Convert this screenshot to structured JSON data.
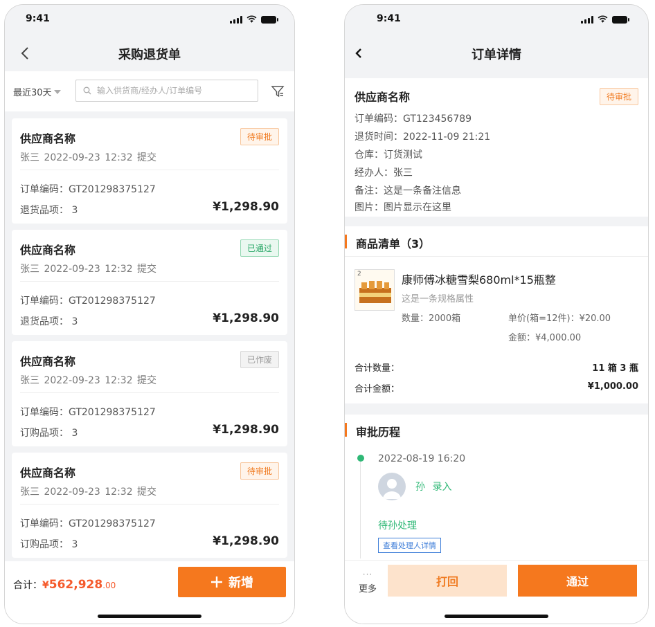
{
  "left": {
    "status_time": "9:41",
    "nav_title": "采购退货单",
    "filter": {
      "range_label": "最近30天",
      "search_placeholder": "输入供货商/经办人/订单编号"
    },
    "cards": [
      {
        "supplier": "供应商名称",
        "status": "待审批",
        "submit_line": "张三 2022-09-23 12:32 提交",
        "order_no": "订单编码：GT201298375127",
        "items": "退货品项： 3",
        "amount": "¥1,298.90"
      },
      {
        "supplier": "供应商名称",
        "status": "已通过",
        "submit_line": "张三 2022-09-23 12:32 提交",
        "order_no": "订单编码：GT201298375127",
        "items": "退货品项： 3",
        "amount": "¥1,298.90"
      },
      {
        "supplier": "供应商名称",
        "status": "已作废",
        "submit_line": "张三 2022-09-23 12:32 提交",
        "order_no": "订单编码：GT201298375127",
        "items": "订购品项： 3",
        "amount": "¥1,298.90"
      },
      {
        "supplier": "供应商名称",
        "status": "待审批",
        "submit_line": "张三 2022-09-23 12:32 提交",
        "order_no": "订单编码：GT201298375127",
        "items": "订购品项： 3",
        "amount": "¥1,298.90"
      }
    ],
    "bottom": {
      "total_label": "合计：",
      "total_symbol": "¥",
      "total_main": "562,928",
      "total_decimal": ".00",
      "add_label": "新增"
    }
  },
  "right": {
    "status_time": "9:41",
    "nav_title": "订单详情",
    "info": {
      "supplier": "供应商名称",
      "status": "待审批",
      "order_no": "订单编码：GT123456789",
      "return_time": "退货时间：2022-11-09 21:21",
      "warehouse": "仓库：订货测试",
      "handler": "经办人：张三",
      "remark": "备注：这是一条备注信息",
      "picture": "图片：图片显示在这里"
    },
    "goods": {
      "title": "商品清单（3）",
      "item": {
        "index": "2",
        "name": "康师傅冰糖雪梨680ml*15瓶整",
        "spec": "这是一条规格属性",
        "qty": "数量：2000箱",
        "unit_price": "单价(箱=12件)：¥20.00",
        "money": "金额：¥4,000.00"
      },
      "total_qty_label": "合计数量：",
      "total_qty": "11 箱 3 瓶",
      "total_amount_label": "合计金额：",
      "total_amount": "¥1,000.00"
    },
    "history": {
      "title": "审批历程",
      "time": "2022-08-19 16:20",
      "user": "孙 录入",
      "status": "待孙处理",
      "link": "查看处理人详情"
    },
    "actions": {
      "more_dots": "···",
      "more_label": "更多",
      "reject": "打回",
      "approve": "通过"
    }
  }
}
